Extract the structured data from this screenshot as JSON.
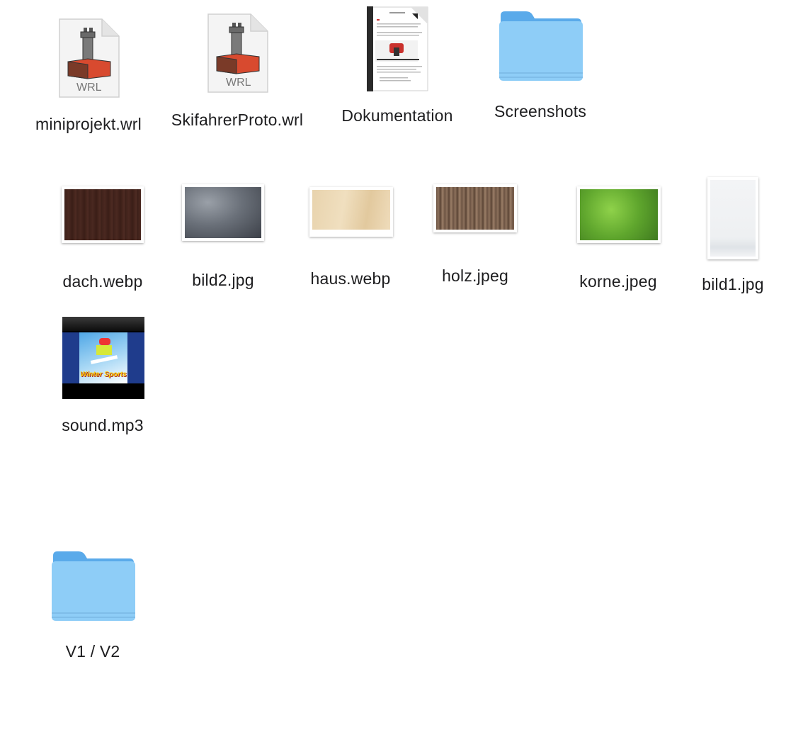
{
  "files": [
    {
      "name": "miniprojekt.wrl",
      "type_badge": "WRL",
      "icon": "vrml-file-icon"
    },
    {
      "name": "SkifahrerProto.wrl",
      "type_badge": "WRL",
      "icon": "vrml-file-icon"
    },
    {
      "name": "Dokumentation",
      "icon": "document-icon"
    },
    {
      "name": "Screenshots",
      "icon": "folder-icon"
    },
    {
      "name": "dach.webp",
      "icon": "image-thumbnail"
    },
    {
      "name": "bild2.jpg",
      "icon": "image-thumbnail"
    },
    {
      "name": "haus.webp",
      "icon": "image-thumbnail"
    },
    {
      "name": "holz.jpeg",
      "icon": "image-thumbnail"
    },
    {
      "name": "korne.jpeg",
      "icon": "image-thumbnail"
    },
    {
      "name": "bild1.jpg",
      "icon": "image-thumbnail"
    },
    {
      "name": "sound.mp3",
      "icon": "album-art-thumbnail",
      "artwork_text": "Winter Sports"
    },
    {
      "name": "V1 / V2",
      "icon": "folder-icon"
    }
  ],
  "colors": {
    "folder_light": "#8fcdf7",
    "folder_dark": "#5fb0ea",
    "label_text": "#1d1d1f",
    "background": "#ffffff"
  }
}
